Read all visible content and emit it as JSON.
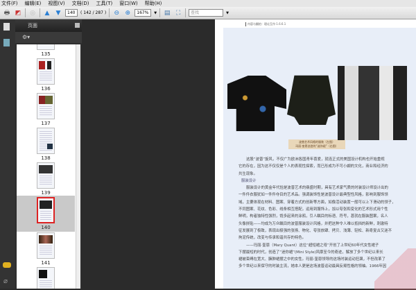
{
  "menu": [
    "文件(F)",
    "编辑(E)",
    "视图(V)",
    "文档(D)",
    "工具(T)",
    "窗口(W)",
    "帮助(H)"
  ],
  "toolbar": {
    "page_input": "140",
    "page_count": "( 142 / 287 )",
    "zoom": "167%",
    "search_placeholder": "查找"
  },
  "panel": {
    "title": "页面"
  },
  "thumbnails": [
    {
      "label": "135"
    },
    {
      "label": "136"
    },
    {
      "label": "137"
    },
    {
      "label": "138"
    },
    {
      "label": "139"
    },
    {
      "label": "140",
      "selected": true
    },
    {
      "label": "141"
    }
  ],
  "document": {
    "running_head": "内容与翻拍：理论互作·1.6.6.1",
    "caption": [
      "波普艺术风格的服装（左图）",
      "玛丽·奎恩创造的“迷你裙”（右图）"
    ],
    "paragraphs": [
      "这股“波普”旋风，不仅广为欧洲各国青年喜爱，就连正式的美国设计机构也开始重视",
      "它的存在，因为这不仅仅是个人的表现性探索，而已形成为不可小觑的文化，商业和经济的",
      "共生现象。",
      "服装设计",
      "服装设计的黄金年代恰是波普艺术的鼎盛时期，具有艺术家气质的时装设计师设计出的",
      "一件件衣服犹如一件件夺目的艺术品。强调装饰性是波普设计最典型性风格，影响到服饰领",
      "域，主要体现在材料、图案、穿着方式的创新等方面，如像活动装置一般可以上下滑动的领子，",
      "不同图案、花纹、色彩、线条相互搭配，运用到服饰上，加以夸张和变化的艺术形式用个性",
      "鲜明，构者独特性强烈，饱多起来的涂鸦，引人瞩目的标语、符号，甚就在服装图案，名人",
      "头像拼贴——均成为万众瞩目的波普服装设计风格，并把这种令人难以抵挡的新鲜，刺激特",
      "征发展到了极致，表现出极强的张扬、物化、夸张放肆、拷贝、浅薄、轻松、新奇复古又迷不",
      "拘泥传统，改变与传承和谐共存的特色。",
      "——玛丽·奎恩（Mary Quant）这位“超短裙之母”开创了上世纪60年代女性裙子",
      "下摆最短的时代，创造了“迷你裙”(Mini Style)风靡至今的奇迹，解放了多个世纪以来长",
      "裙被束缚在宽大、臃肿裙摆之中的女性。玛丽·奎恩领导的这场时装运动狂飙，不但改革了",
      "多个世纪以来保守的时装主流，她本人更是这场波普运动最具反叛性格的领袖。1966年因"
    ]
  },
  "colors": {
    "selection": "#d22222",
    "dark": "#2b2b2b"
  }
}
